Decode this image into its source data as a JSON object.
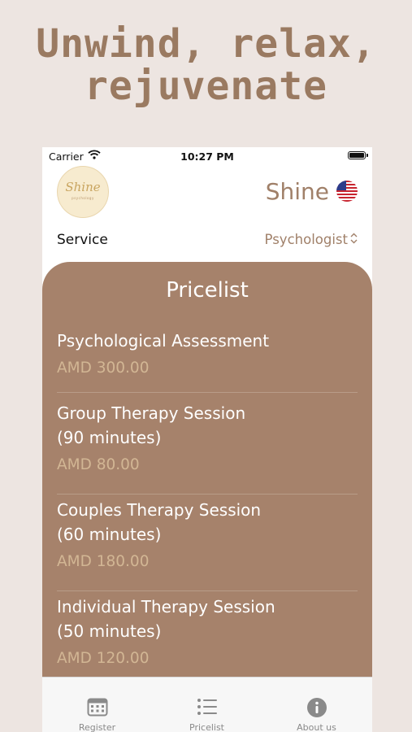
{
  "headline": {
    "line1": "Unwind, relax,",
    "line2": "rejuvenate"
  },
  "status_bar": {
    "carrier": "Carrier",
    "time": "10:27 PM"
  },
  "header": {
    "logo_text": "Shine",
    "logo_subtext": "psychology",
    "brand": "Shine",
    "flag_icon": "us-flag-icon"
  },
  "service": {
    "label": "Service",
    "selected": "Psychologist"
  },
  "pricelist": {
    "title": "Pricelist",
    "items": [
      {
        "name_line1": "Psychological Assessment",
        "name_line2": "",
        "price": "AMD 300.00"
      },
      {
        "name_line1": "Group Therapy Session",
        "name_line2": "(90 minutes)",
        "price": "AMD 80.00"
      },
      {
        "name_line1": "Couples Therapy Session",
        "name_line2": "(60 minutes)",
        "price": "AMD 180.00"
      },
      {
        "name_line1": "Individual Therapy Session",
        "name_line2": "(50 minutes)",
        "price": "AMD 120.00"
      }
    ]
  },
  "tabbar": {
    "tabs": [
      {
        "label": "Register",
        "icon": "calendar-icon"
      },
      {
        "label": "Pricelist",
        "icon": "list-icon"
      },
      {
        "label": "About us",
        "icon": "info-icon"
      }
    ]
  },
  "colors": {
    "accent": "#a6826b",
    "price": "#d2b694",
    "brand": "#a08069",
    "background": "#ede5e1"
  }
}
